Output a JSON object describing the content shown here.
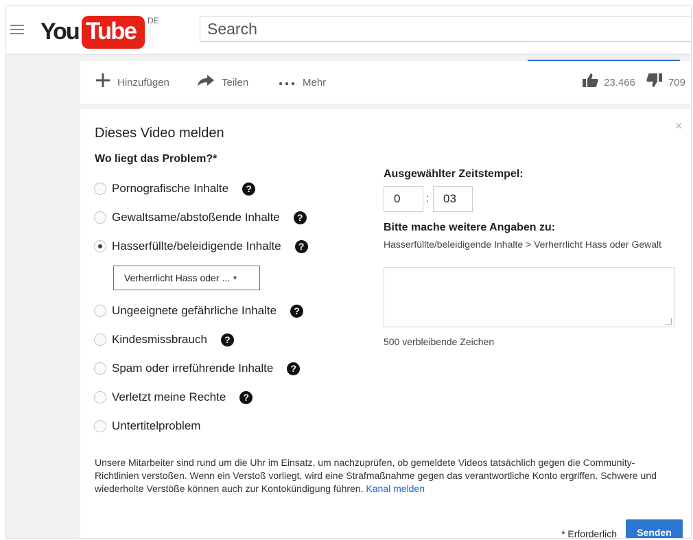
{
  "header": {
    "logo_you": "You",
    "logo_tube": "Tube",
    "region": "DE",
    "search_placeholder": "Search"
  },
  "actions": {
    "add": "Hinzufügen",
    "share": "Teilen",
    "more": "Mehr",
    "likes": "23.466",
    "dislikes": "709"
  },
  "dialog": {
    "title": "Dieses Video melden",
    "close": "×",
    "question": "Wo liegt das Problem?*",
    "options": [
      {
        "label": "Pornografische Inhalte",
        "selected": false,
        "help": true
      },
      {
        "label": "Gewaltsame/abstoßende Inhalte",
        "selected": false,
        "help": true
      },
      {
        "label": "Hasserfüllte/beleidigende Inhalte",
        "selected": true,
        "help": true
      },
      {
        "label": "Ungeeignete gefährliche Inhalte",
        "selected": false,
        "help": true
      },
      {
        "label": "Kindesmissbrauch",
        "selected": false,
        "help": true
      },
      {
        "label": "Spam oder irreführende Inhalte",
        "selected": false,
        "help": true
      },
      {
        "label": "Verletzt meine Rechte",
        "selected": false,
        "help": true
      },
      {
        "label": "Untertitelproblem",
        "selected": false,
        "help": false
      }
    ],
    "help_glyph": "?",
    "subselect_value": "Verherrlicht Hass oder ...",
    "timestamp": {
      "label": "Ausgewählter Zeitstempel:",
      "minutes": "0",
      "separator": ":",
      "seconds": "03"
    },
    "details": {
      "label": "Bitte mache weitere Angaben zu:",
      "path": "Hasserfüllte/beleidigende Inhalte > Verherrlicht Hass oder Gewalt",
      "remaining": "500 verbleibende Zeichen"
    },
    "footnote": "Unsere Mitarbeiter sind rund um die Uhr im Einsatz, um nachzuprüfen, ob gemeldete Videos tatsächlich gegen die Community-Richtlinien verstoßen. Wenn ein Verstoß vorliegt, wird eine Strafmaßnahme gegen das verantwortliche Konto ergriffen. Schwere und wiederholte Verstöße können auch zur Kontokündigung führen.",
    "footnote_link": "Kanal melden",
    "required_note": "* Erforderlich",
    "submit": "Senden"
  },
  "colors": {
    "brand_red": "#e62117",
    "accent_blue": "#2e77d0",
    "link_blue": "#2565c4"
  }
}
